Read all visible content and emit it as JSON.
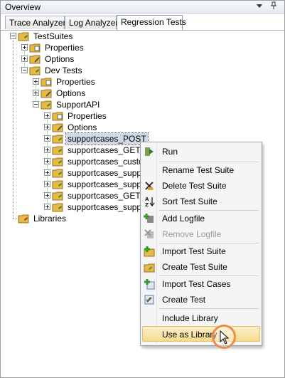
{
  "header": {
    "title": "Overview",
    "pin_icon": "pin-icon",
    "dropdown_icon": "window-position-icon"
  },
  "tabs": [
    {
      "label": "Trace Analyzer",
      "active": false
    },
    {
      "label": "Log Analyzer",
      "active": false
    },
    {
      "label": "Regression Tests",
      "active": true
    }
  ],
  "tree": {
    "root": "TestSuites",
    "root_items": [
      {
        "label": "Properties",
        "icon": "properties-icon"
      },
      {
        "label": "Options",
        "icon": "options-icon"
      },
      {
        "label": "Dev Tests",
        "icon": "folder-icon"
      }
    ],
    "dev_tests_items": [
      {
        "label": "Properties",
        "icon": "properties-icon"
      },
      {
        "label": "Options",
        "icon": "options-icon"
      },
      {
        "label": "SupportAPI",
        "icon": "folder-icon"
      }
    ],
    "support_api_items": [
      {
        "label": "Properties",
        "icon": "properties-icon"
      },
      {
        "label": "Options",
        "icon": "options-icon"
      },
      {
        "label": "supportcases_POST",
        "icon": "folder-icon",
        "selected": true
      },
      {
        "label": "supportcases_GET",
        "icon": "folder-icon"
      },
      {
        "label": "supportcases_custo",
        "icon": "folder-icon"
      },
      {
        "label": "supportcases_supp",
        "icon": "folder-icon"
      },
      {
        "label": "supportcases_supp",
        "icon": "folder-icon"
      },
      {
        "label": "supportcases_GET_",
        "icon": "folder-icon"
      },
      {
        "label": "supportcases_supp",
        "icon": "folder-icon"
      }
    ],
    "libraries": "Libraries"
  },
  "context_menu": {
    "items": [
      {
        "label": "Run",
        "icon": "run-icon",
        "enabled": true
      },
      {
        "label": "Rename Test Suite",
        "icon": "",
        "enabled": true
      },
      {
        "label": "Delete Test Suite",
        "icon": "delete-icon",
        "enabled": true
      },
      {
        "label": "Sort Test Suite",
        "icon": "sort-az-icon",
        "enabled": true
      },
      {
        "label": "Add Logfile",
        "icon": "add-logfile-icon",
        "enabled": true
      },
      {
        "label": "Remove Logfile",
        "icon": "remove-logfile-icon",
        "enabled": false
      },
      {
        "label": "Import Test Suite",
        "icon": "import-suite-icon",
        "enabled": true
      },
      {
        "label": "Create Test Suite",
        "icon": "create-suite-icon",
        "enabled": true
      },
      {
        "label": "Import Test Cases",
        "icon": "import-cases-icon",
        "enabled": true
      },
      {
        "label": "Create Test",
        "icon": "create-test-icon",
        "enabled": true
      },
      {
        "label": "Include Library",
        "icon": "",
        "enabled": true
      },
      {
        "label": "Use as Library",
        "icon": "",
        "enabled": true,
        "hovered": true
      }
    ]
  },
  "colors": {
    "selection": "#cfd9e6",
    "menu_hover": "#f6dc8f",
    "cursor_ring": "#f08a4b"
  }
}
